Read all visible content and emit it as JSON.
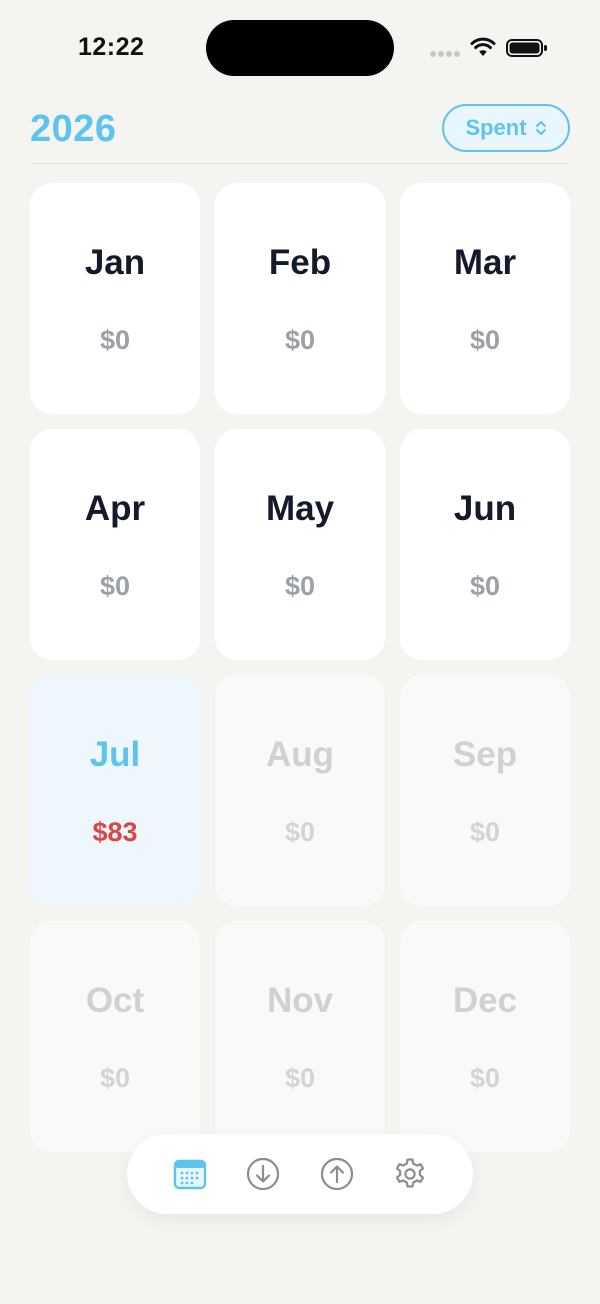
{
  "status_bar": {
    "time": "12:22"
  },
  "header": {
    "year": "2026",
    "mode_label": "Spent"
  },
  "months": [
    {
      "name": "Jan",
      "amount": "$0",
      "state": "past"
    },
    {
      "name": "Feb",
      "amount": "$0",
      "state": "past"
    },
    {
      "name": "Mar",
      "amount": "$0",
      "state": "past"
    },
    {
      "name": "Apr",
      "amount": "$0",
      "state": "past"
    },
    {
      "name": "May",
      "amount": "$0",
      "state": "past"
    },
    {
      "name": "Jun",
      "amount": "$0",
      "state": "past"
    },
    {
      "name": "Jul",
      "amount": "$83",
      "state": "current"
    },
    {
      "name": "Aug",
      "amount": "$0",
      "state": "future"
    },
    {
      "name": "Sep",
      "amount": "$0",
      "state": "future"
    },
    {
      "name": "Oct",
      "amount": "$0",
      "state": "future"
    },
    {
      "name": "Nov",
      "amount": "$0",
      "state": "future"
    },
    {
      "name": "Dec",
      "amount": "$0",
      "state": "future"
    }
  ],
  "tab_bar": {
    "items": [
      {
        "icon": "calendar-icon",
        "active": true
      },
      {
        "icon": "arrow-down-circle-icon",
        "active": false
      },
      {
        "icon": "arrow-up-circle-icon",
        "active": false
      },
      {
        "icon": "gear-icon",
        "active": false
      }
    ]
  },
  "colors": {
    "accent": "#5ec4ef",
    "negative": "#e04343",
    "background": "#f4f4f1"
  }
}
